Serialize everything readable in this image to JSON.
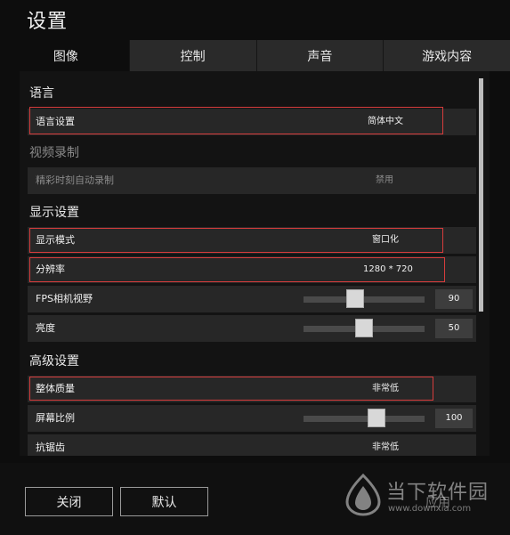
{
  "window": {
    "title": "设置"
  },
  "tabs": [
    {
      "label": "图像",
      "active": true
    },
    {
      "label": "控制",
      "active": false
    },
    {
      "label": "声音",
      "active": false
    },
    {
      "label": "游戏内容",
      "active": false
    }
  ],
  "sections": {
    "language": "语言",
    "video_recording": "视频录制",
    "display": "显示设置",
    "advanced": "高级设置"
  },
  "settings": {
    "language": {
      "label": "语言设置",
      "value": "简体中文"
    },
    "highlight_record": {
      "label": "精彩时刻自动录制",
      "value": "禁用"
    },
    "display_mode": {
      "label": "显示模式",
      "value": "窗口化"
    },
    "resolution": {
      "label": "分辨率",
      "value": "1280 * 720"
    },
    "fps_fov": {
      "label": "FPS相机视野",
      "value": "90",
      "slider_fraction": 0.43
    },
    "brightness": {
      "label": "亮度",
      "value": "50",
      "slider_fraction": 0.5
    },
    "overall_quality": {
      "label": "整体质量",
      "value": "非常低"
    },
    "screen_scale": {
      "label": "屏幕比例",
      "value": "100",
      "slider_fraction": 0.6
    },
    "anti_aliasing": {
      "label": "抗锯齿",
      "value": "非常低"
    }
  },
  "buttons": {
    "close": "关闭",
    "default": "默认",
    "apply": "应用"
  },
  "watermark": {
    "name": "当下软件园",
    "url": "www.downxia.com"
  },
  "colors": {
    "highlight_border": "#d63c3c",
    "row_bg": "#272727",
    "panel_bg": "#131313"
  }
}
